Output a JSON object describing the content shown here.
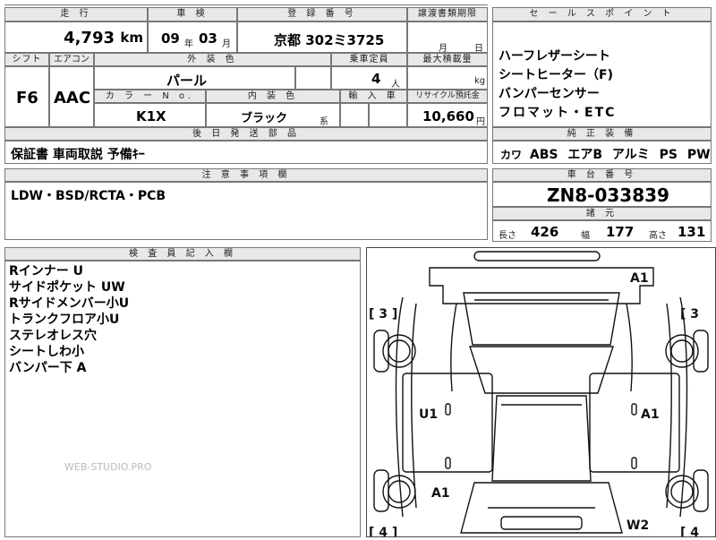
{
  "headers": {
    "mileage": "走 行",
    "inspection": "車 検",
    "registration": "登 録 番 号",
    "transfer": "譲渡書類期限",
    "sales_points": "セ ー ル ス ポ イ ン ト",
    "shift": "シフト",
    "aircon": "エアコン",
    "exterior_color": "外 装 色",
    "capacity": "乗車定員",
    "max_load": "最大積載量",
    "color_no": "カ ラ ー N o.",
    "interior_color": "内 装 色",
    "import": "輸 入 車",
    "recycle": "リサイクル預託金",
    "genuine_equipment": "純 正 装 備",
    "rear_parts": "後 日 発 送 部 品",
    "notes": "注 意 事 項 欄",
    "chassis_no": "車 台 番 号",
    "specs": "諸 元",
    "inspector": "検 査 員 記 入 欄"
  },
  "mileage": {
    "value": "4,793",
    "unit": "km"
  },
  "inspection": {
    "year": "09",
    "year_unit": "年",
    "month": "03",
    "month_unit": "月"
  },
  "registration": {
    "value": "京都 302ミ3725"
  },
  "transfer": {
    "month_unit": "月",
    "day_unit": "日"
  },
  "shift": "F6",
  "aircon": "AAC",
  "exterior_color": "パール",
  "capacity": {
    "value": "4",
    "unit": "人"
  },
  "max_load": {
    "unit": "kg"
  },
  "color_no": "K1X",
  "interior_color": {
    "value": "ブラック",
    "suffix": "系"
  },
  "recycle": {
    "value": "10,660",
    "unit": "円"
  },
  "sales_points": [
    "ハーフレザーシート",
    "シートヒーター（F)",
    "バンパーセンサー",
    "フロマット・ETC"
  ],
  "genuine_equipment": [
    "カワ",
    "ABS",
    "エアB",
    "アルミ",
    "PS",
    "PW"
  ],
  "rear_parts": "保証書 車両取説 予備ｷｰ",
  "notes": "LDW・BSD/RCTA・PCB",
  "chassis_no": "ZN8-033839",
  "specs": {
    "length_label": "長さ",
    "length": "426",
    "width_label": "幅",
    "width": "177",
    "height_label": "高さ",
    "height": "131"
  },
  "inspector_notes": [
    "Rインナー U",
    "サイドポケット UW",
    "Rサイドメンバー小U",
    "トランクフロア小U",
    "ステレオレス穴",
    "シートしわ小",
    "バンパー下 A"
  ],
  "diagram": {
    "marks": {
      "a1_top": "A1",
      "bracket_left": "[ 3 ]",
      "bracket_right": "[ 3",
      "u1": "U1",
      "a1_right": "A1",
      "a1_left_bottom": "A1",
      "w2": "W2",
      "bracket_bl": "[ 4 ]",
      "bracket_br": "[ 4"
    }
  },
  "watermark": "WEB-STUDIO.PRO"
}
